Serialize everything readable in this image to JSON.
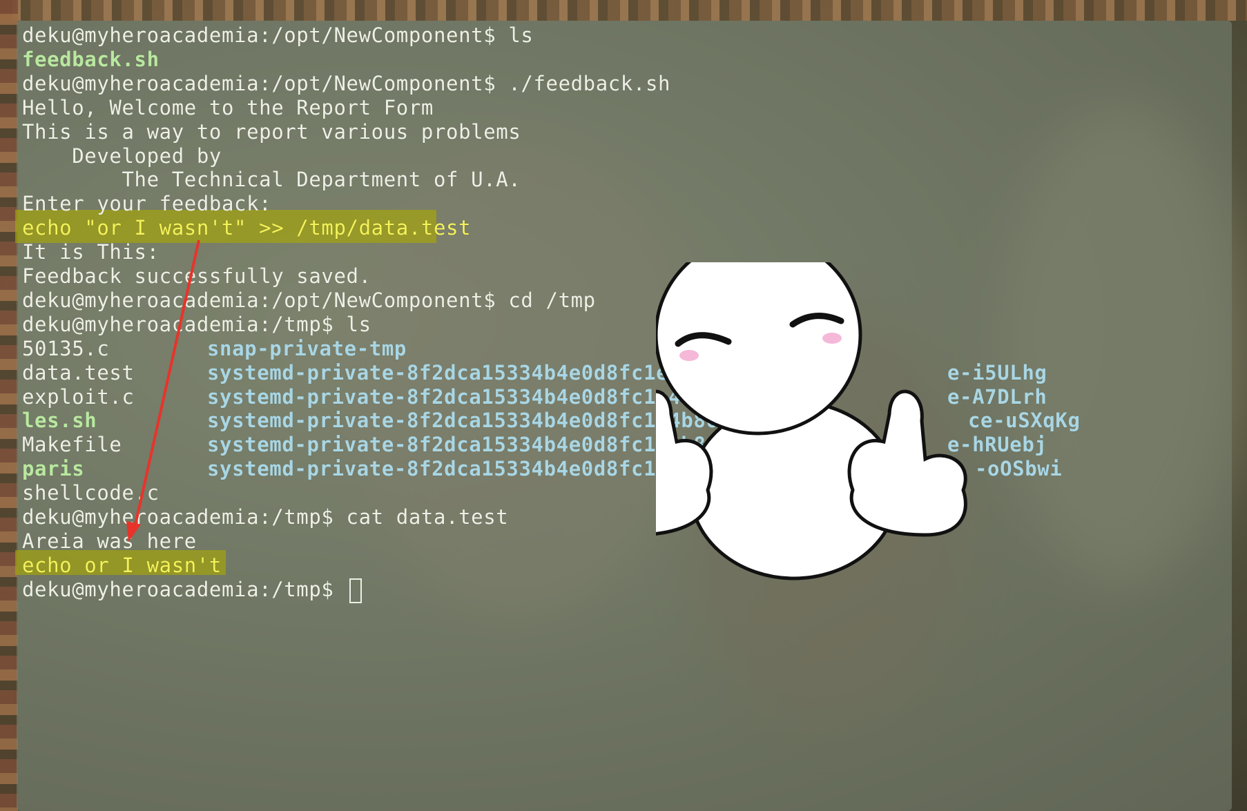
{
  "terminal": {
    "lines": [
      {
        "prompt": "deku@myheroacademia:/opt/NewComponent$",
        "cmd": " ls"
      },
      {
        "text": "feedback.sh",
        "style": "exec"
      },
      {
        "prompt": "deku@myheroacademia:/opt/NewComponent$",
        "cmd": " ./feedback.sh"
      },
      {
        "text": "Hello, Welcome to the Report Form"
      },
      {
        "text": "This is a way to report various problems"
      },
      {
        "text": "    Developed by"
      },
      {
        "text": "        The Technical Department of U.A."
      },
      {
        "text": "Enter your feedback:"
      },
      {
        "text": "echo \"or I wasn't\" >> /tmp/data.test",
        "style": "highlight"
      },
      {
        "text": "It is This:"
      },
      {
        "text": "Feedback successfully saved."
      },
      {
        "prompt": "deku@myheroacademia:/opt/NewComponent$",
        "cmd": " cd /tmp"
      },
      {
        "prompt": "deku@myheroacademia:/tmp$",
        "cmd": " ls"
      }
    ],
    "ls_listing": [
      {
        "left": "50135.c",
        "left_style": "plain",
        "right": "snap-private-tmp",
        "right_style": "dir"
      },
      {
        "left": "data.test",
        "left_style": "plain",
        "right": "systemd-private-8f2dca15334b4e0d8fc1e4b86ae3ace",
        "right_tail": "e-i5ULhg",
        "right_style": "dir"
      },
      {
        "left": "exploit.c",
        "left_style": "plain",
        "right": "systemd-private-8f2dca15334b4e0d8fc1e4b86ae3acda",
        "right_tail": "e-A7DLrh",
        "right_style": "dir"
      },
      {
        "left": "les.sh",
        "left_style": "exec",
        "right": "systemd-private-8f2dca15334b4e0d8fc1e4b86a",
        "right_tail": "ce-uSXqKg",
        "right_style": "dir"
      },
      {
        "left": "Makefile",
        "left_style": "plain",
        "right": "systemd-private-8f2dca15334b4e0d8fc1e4b86a",
        "right_tail": "e-hRUebj",
        "right_style": "dir"
      },
      {
        "left": "paris",
        "left_style": "exec",
        "right": "systemd-private-8f2dca15334b4e0d8fc1e4b86",
        "right_tail": "-oOSbwi",
        "right_style": "dir"
      },
      {
        "left": "shellcode.c",
        "left_style": "plain",
        "right": "",
        "right_style": "dir"
      }
    ],
    "after": [
      {
        "prompt": "deku@myheroacademia:/tmp$",
        "cmd": " cat data.test"
      },
      {
        "text": "Areia was here"
      },
      {
        "text": "echo or I wasn't",
        "style": "highlight"
      },
      {
        "prompt": "deku@myheroacademia:/tmp$",
        "cmd": " ",
        "cursor": true
      }
    ]
  },
  "colors": {
    "text": "#eef0e6",
    "exec": "#b9e8a0",
    "dir": "#a9d6e4",
    "highlight_bg": "#aaaa00",
    "highlight_text": "#f4f25a",
    "arrow": "#e8332b"
  },
  "annotations": {
    "arrow": "red-arrow",
    "sticker": "thumbs-up-blob-character"
  }
}
